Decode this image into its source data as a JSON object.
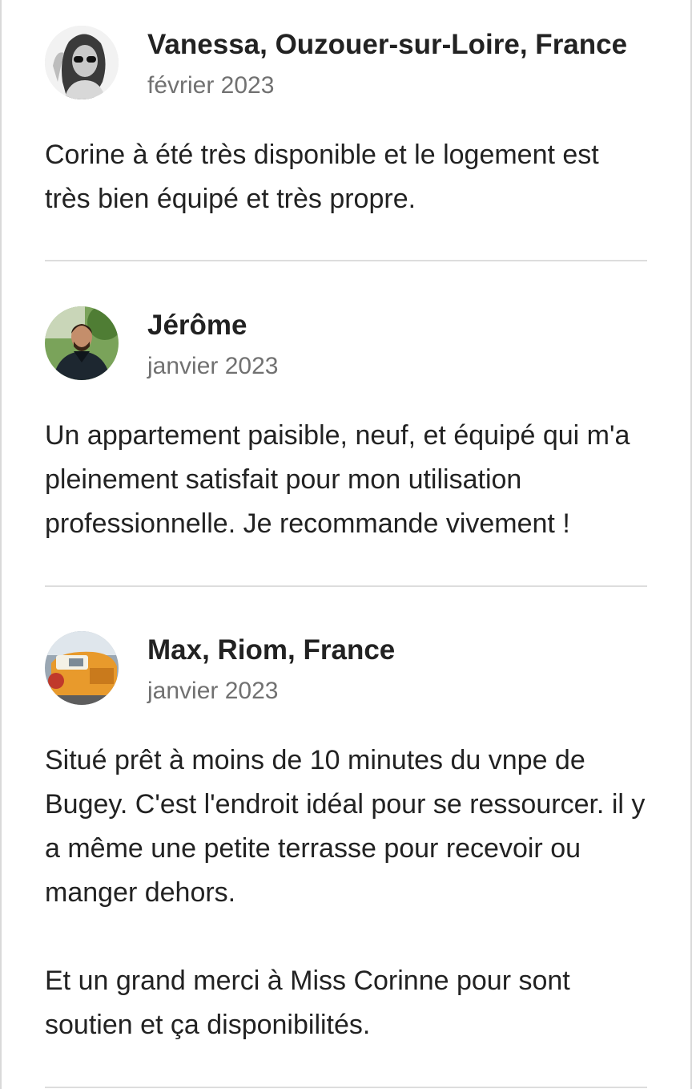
{
  "reviews": [
    {
      "name": "Vanessa, Ouzouer-sur-Loire, France",
      "date": "février 2023",
      "text": [
        "Corine à été très disponible et le logement est très bien équipé et très propre."
      ],
      "avatar_icon": "reviewer-photo-vanessa"
    },
    {
      "name": "Jérôme",
      "date": "janvier 2023",
      "text": [
        "Un appartement paisible, neuf, et équipé qui m'a pleinement satisfait pour mon utilisation professionnelle. Je recommande vivement !"
      ],
      "avatar_icon": "reviewer-photo-jerome"
    },
    {
      "name": "Max, Riom, France",
      "date": "janvier 2023",
      "text": [
        "Situé prêt à moins de 10 minutes du vnpe de Bugey.  C'est l'endroit idéal pour se ressourcer. il y a même une petite terrasse pour recevoir ou manger dehors.",
        "Et un grand merci à Miss Corinne pour sont soutien et ça disponibilités."
      ],
      "avatar_icon": "reviewer-photo-max"
    }
  ],
  "colors": {
    "text_primary": "#222222",
    "text_secondary": "#717171",
    "divider": "#dddddd"
  }
}
